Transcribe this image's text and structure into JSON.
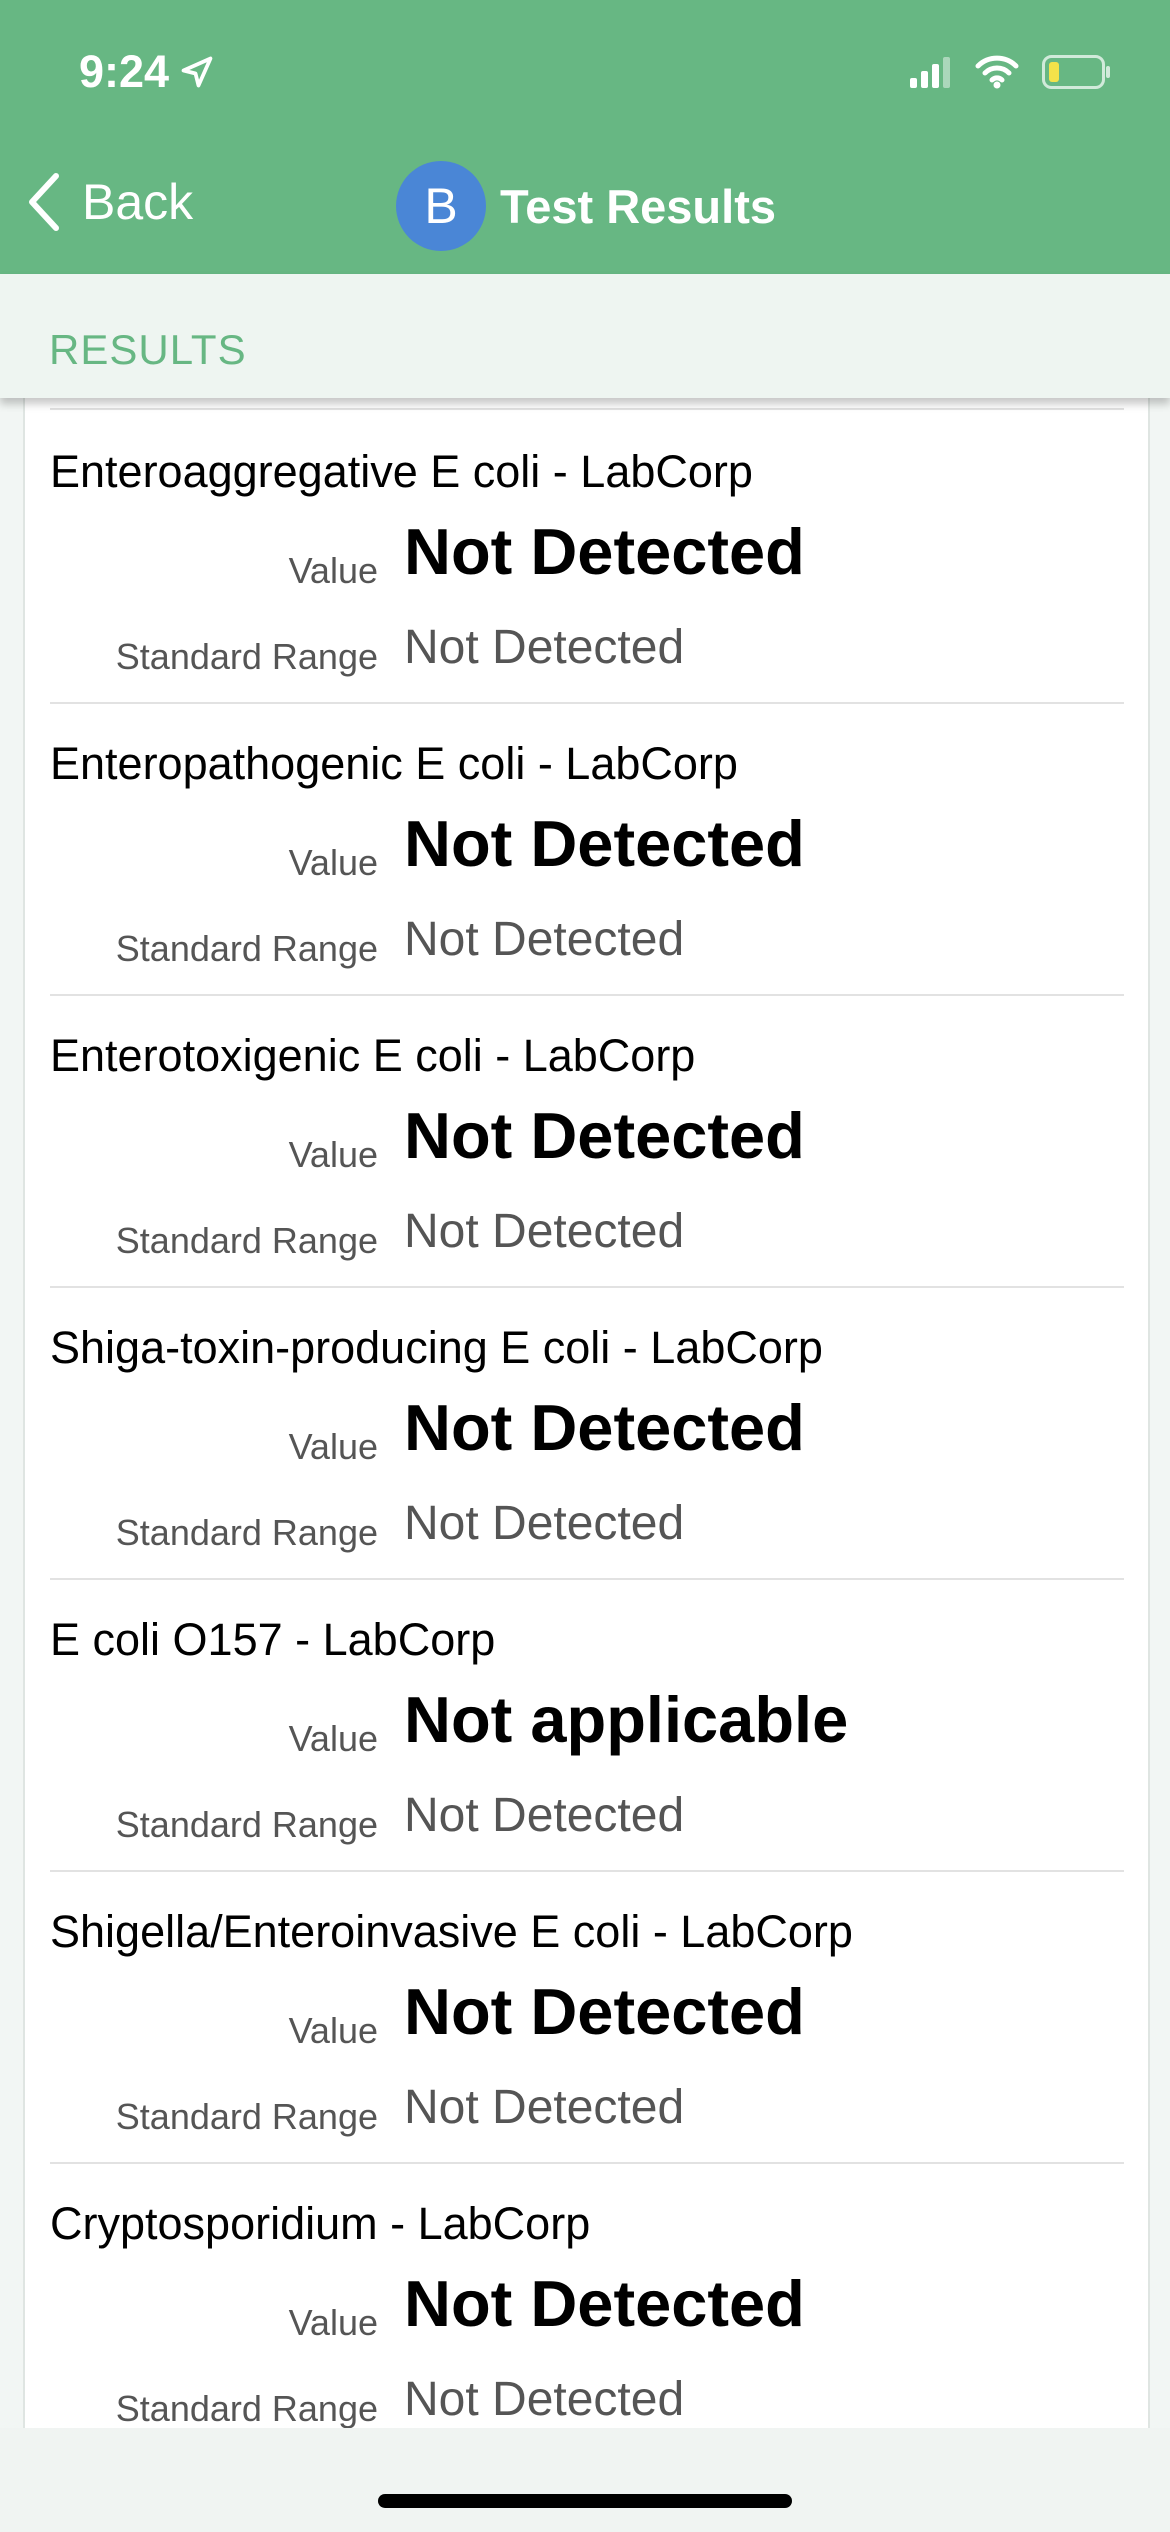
{
  "status": {
    "time": "9:24"
  },
  "nav": {
    "back_label": "Back",
    "avatar_letter": "B",
    "title": "Test Results"
  },
  "section": {
    "label": "RESULTS"
  },
  "results": [
    {
      "name": "Enteroaggregative E coli - LabCorp",
      "value_label": "Value",
      "value": "Not Detected",
      "range_label": "Standard Range",
      "range": "Not Detected"
    },
    {
      "name": "Enteropathogenic E coli - LabCorp",
      "value_label": "Value",
      "value": "Not Detected",
      "range_label": "Standard Range",
      "range": "Not Detected"
    },
    {
      "name": "Enterotoxigenic E coli - LabCorp",
      "value_label": "Value",
      "value": "Not Detected",
      "range_label": "Standard Range",
      "range": "Not Detected"
    },
    {
      "name": "Shiga-toxin-producing E coli - LabCorp",
      "value_label": "Value",
      "value": "Not Detected",
      "range_label": "Standard Range",
      "range": "Not Detected"
    },
    {
      "name": "E coli O157 - LabCorp",
      "value_label": "Value",
      "value": "Not applicable",
      "range_label": "Standard Range",
      "range": "Not Detected"
    },
    {
      "name": "Shigella/Enteroinvasive E coli - LabCorp",
      "value_label": "Value",
      "value": "Not Detected",
      "range_label": "Standard Range",
      "range": "Not Detected"
    },
    {
      "name": "Cryptosporidium - LabCorp",
      "value_label": "Value",
      "value": "Not Detected",
      "range_label": "Standard Range",
      "range": "Not Detected"
    }
  ],
  "colors": {
    "header": "#67b783",
    "avatar": "#4a86d6",
    "section_text": "#67b783"
  }
}
